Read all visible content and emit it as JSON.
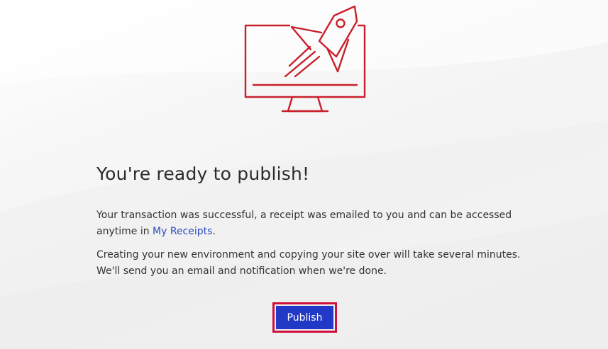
{
  "hero": {
    "illustration_icon": "rocket-launch-monitor-icon",
    "accent_color": "#c8202b"
  },
  "main": {
    "title": "You're ready to publish!",
    "paragraph1_text": "Your transaction was successful, a receipt was emailed to you and can be accessed anytime in ",
    "paragraph1_link": "My Receipts",
    "paragraph1_suffix": ".",
    "paragraph2_text": "Creating your new environment and copying your site over will take several minutes. We'll send you an email and notification when we're done."
  },
  "actions": {
    "publish_label": "Publish",
    "publish_color": "#2238c6",
    "highlight_color": "#d0103a"
  },
  "colors": {
    "link": "#2e4bbf",
    "text": "#333333"
  }
}
